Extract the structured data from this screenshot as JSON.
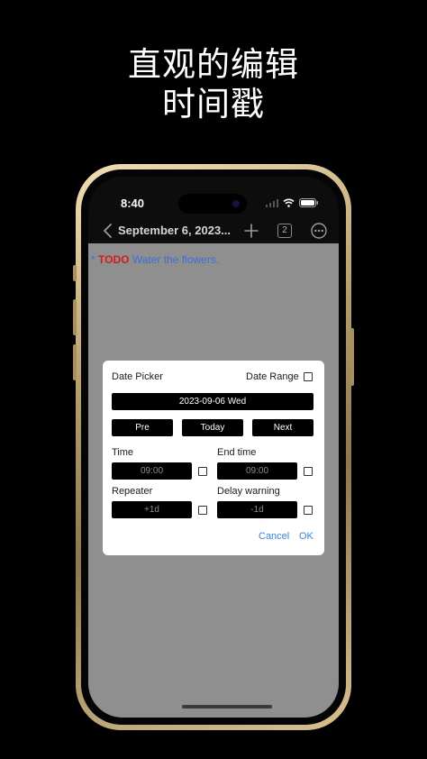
{
  "promo": {
    "line1": "直观的编辑",
    "line2": "时间戳"
  },
  "status_bar": {
    "time": "8:40",
    "icons": [
      "signal-icon",
      "wifi-icon",
      "battery-icon"
    ]
  },
  "nav": {
    "title": "September 6, 2023...",
    "pages_count": "2"
  },
  "note": {
    "marker": "*",
    "keyword": "TODO",
    "text": "Water the flowers."
  },
  "dialog": {
    "title": "Date Picker",
    "date_range_label": "Date Range",
    "date_range_checked": false,
    "selected_date": "2023-09-06 Wed",
    "pre_label": "Pre",
    "today_label": "Today",
    "next_label": "Next",
    "time_label": "Time",
    "time_value": "09:00",
    "end_time_label": "End time",
    "end_time_value": "09:00",
    "repeater_label": "Repeater",
    "repeater_value": "+1d",
    "delay_label": "Delay warning",
    "delay_value": "-1d",
    "cancel_label": "Cancel",
    "ok_label": "OK"
  },
  "colors": {
    "keyword": "#d11d1d",
    "task_text": "#3b6fd6",
    "link": "#3b82d6",
    "content_bg": "#8f8f8f",
    "frame_gold": "#c9b07d"
  }
}
